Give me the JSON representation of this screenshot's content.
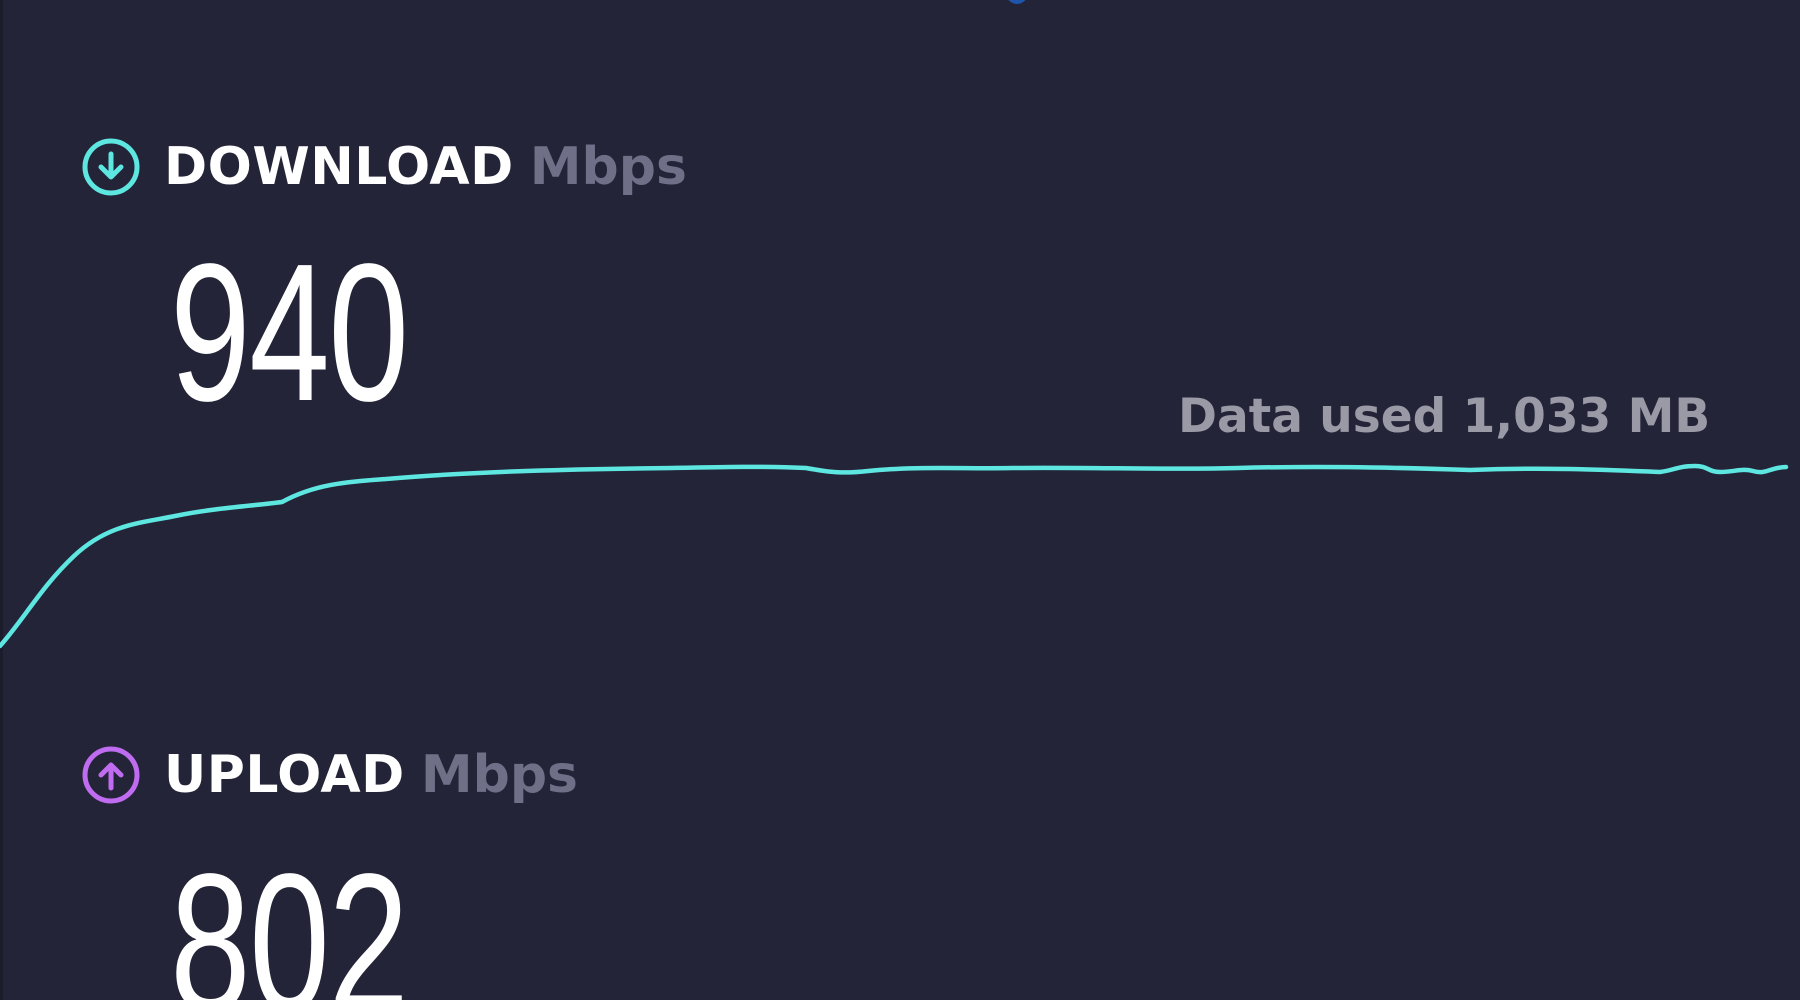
{
  "download": {
    "label": "DOWNLOAD",
    "unit": "Mbps",
    "value": "940",
    "icon": "arrow-down-circle-icon",
    "accent": "#5ee6e1"
  },
  "upload": {
    "label": "UPLOAD",
    "unit": "Mbps",
    "value": "802",
    "icon": "arrow-up-circle-icon",
    "accent": "#c06cf0"
  },
  "graph": {
    "data_used": "Data used 1,033 MB",
    "line_color": "#5ee6e1"
  }
}
